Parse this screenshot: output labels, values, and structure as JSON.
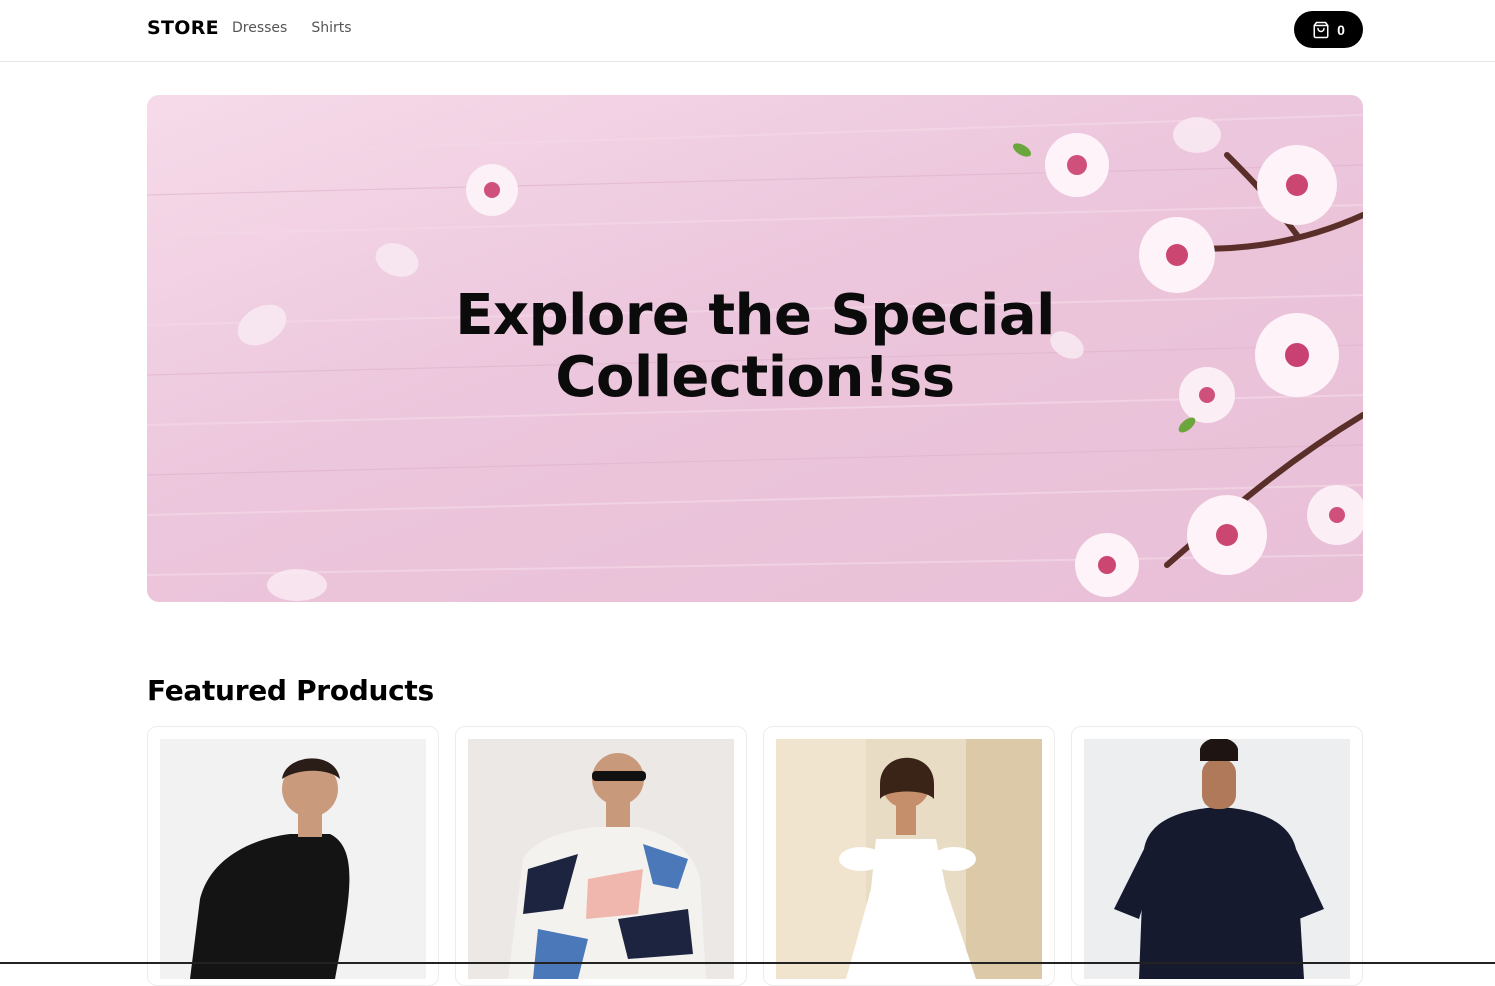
{
  "navbar": {
    "brand": "STORE",
    "links": [
      {
        "label": "Dresses"
      },
      {
        "label": "Shirts"
      }
    ],
    "cart": {
      "icon": "shopping-bag-icon",
      "count": "0"
    }
  },
  "hero": {
    "title_line1": "Explore the Special",
    "title_line2": "Collection!ss",
    "image": "cherry-blossom-banner"
  },
  "featured": {
    "title": "Featured Products",
    "products": [
      {
        "image": "man-black-sweater"
      },
      {
        "image": "man-geometric-print-shirt"
      },
      {
        "image": "woman-white-dress"
      },
      {
        "image": "man-navy-tshirt-back"
      }
    ]
  },
  "colors": {
    "accent": "#000000",
    "hero_bg": "#ecc6dc",
    "border": "#ececec"
  }
}
